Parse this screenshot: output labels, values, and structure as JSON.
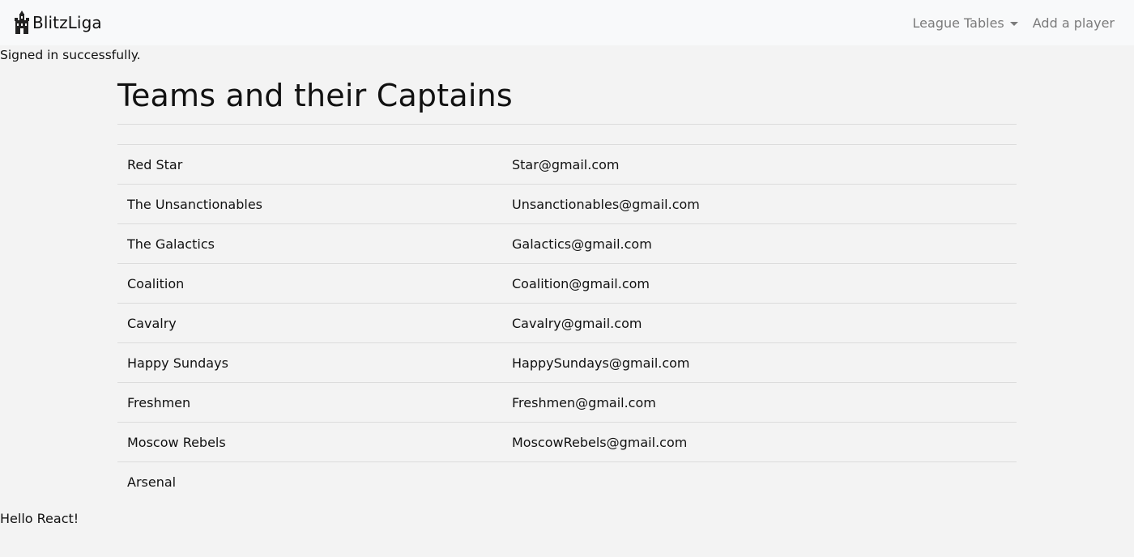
{
  "navbar": {
    "brand": "BlitzLiga",
    "league_tables": "League Tables",
    "add_player": "Add a player"
  },
  "flash": "Signed in successfully.",
  "page_title": "Teams and their Captains",
  "teams": [
    {
      "name": "Red Star",
      "captain": "Star@gmail.com"
    },
    {
      "name": "The Unsanctionables",
      "captain": "Unsanctionables@gmail.com"
    },
    {
      "name": "The Galactics",
      "captain": "Galactics@gmail.com"
    },
    {
      "name": "Coalition",
      "captain": "Coalition@gmail.com"
    },
    {
      "name": "Cavalry",
      "captain": "Cavalry@gmail.com"
    },
    {
      "name": "Happy Sundays",
      "captain": "HappySundays@gmail.com"
    },
    {
      "name": "Freshmen",
      "captain": "Freshmen@gmail.com"
    },
    {
      "name": "Moscow Rebels",
      "captain": "MoscowRebels@gmail.com"
    },
    {
      "name": "Arsenal",
      "captain": ""
    }
  ],
  "footer": "Hello React!"
}
